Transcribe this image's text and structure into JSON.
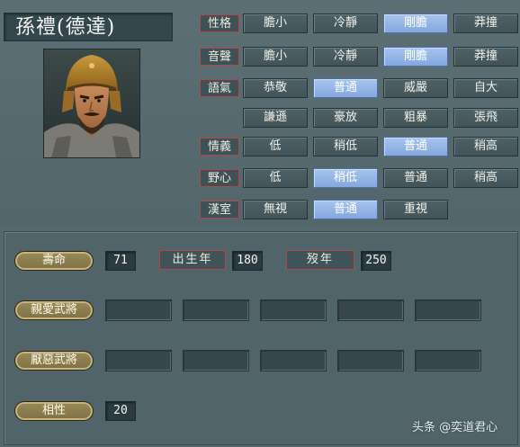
{
  "character": {
    "name": "孫禮(德達)"
  },
  "rows": [
    {
      "label": "性格",
      "options": [
        "膽小",
        "冷靜",
        "剛膽",
        "莽撞"
      ],
      "selected": 2
    },
    {
      "label": "音聲",
      "options": [
        "膽小",
        "冷靜",
        "剛膽",
        "莽撞"
      ],
      "selected": 2
    },
    {
      "label": "語氣",
      "options": [
        "恭敬",
        "普通",
        "威嚴",
        "自大"
      ],
      "selected": 1
    },
    {
      "label": "",
      "options": [
        "謙遜",
        "豪放",
        "粗暴",
        "張飛"
      ],
      "selected": -1
    },
    {
      "label": "情義",
      "options": [
        "低",
        "稍低",
        "普通",
        "稍高"
      ],
      "selected": 2
    },
    {
      "label": "野心",
      "options": [
        "低",
        "稍低",
        "普通",
        "稍高"
      ],
      "selected": 1
    },
    {
      "label": "漢室",
      "options": [
        "無視",
        "普通",
        "重視"
      ],
      "selected": 1
    }
  ],
  "lifespan": {
    "label": "壽命",
    "value": "71"
  },
  "birth_year": {
    "label": "出生年",
    "value": "180"
  },
  "death_year": {
    "label": "歿年",
    "value": "250"
  },
  "liked_generals": {
    "label": "親愛武將",
    "slots": [
      "",
      "",
      "",
      "",
      ""
    ]
  },
  "disliked_generals": {
    "label": "厭惡武將",
    "slots": [
      "",
      "",
      "",
      "",
      ""
    ]
  },
  "compatibility": {
    "label": "相性",
    "value": "20"
  },
  "watermark": "头条 @奕道君心",
  "colors": {
    "selected": "#92b2e6",
    "label_border": "#b04848",
    "pill_gold": "#9a8a5a"
  }
}
